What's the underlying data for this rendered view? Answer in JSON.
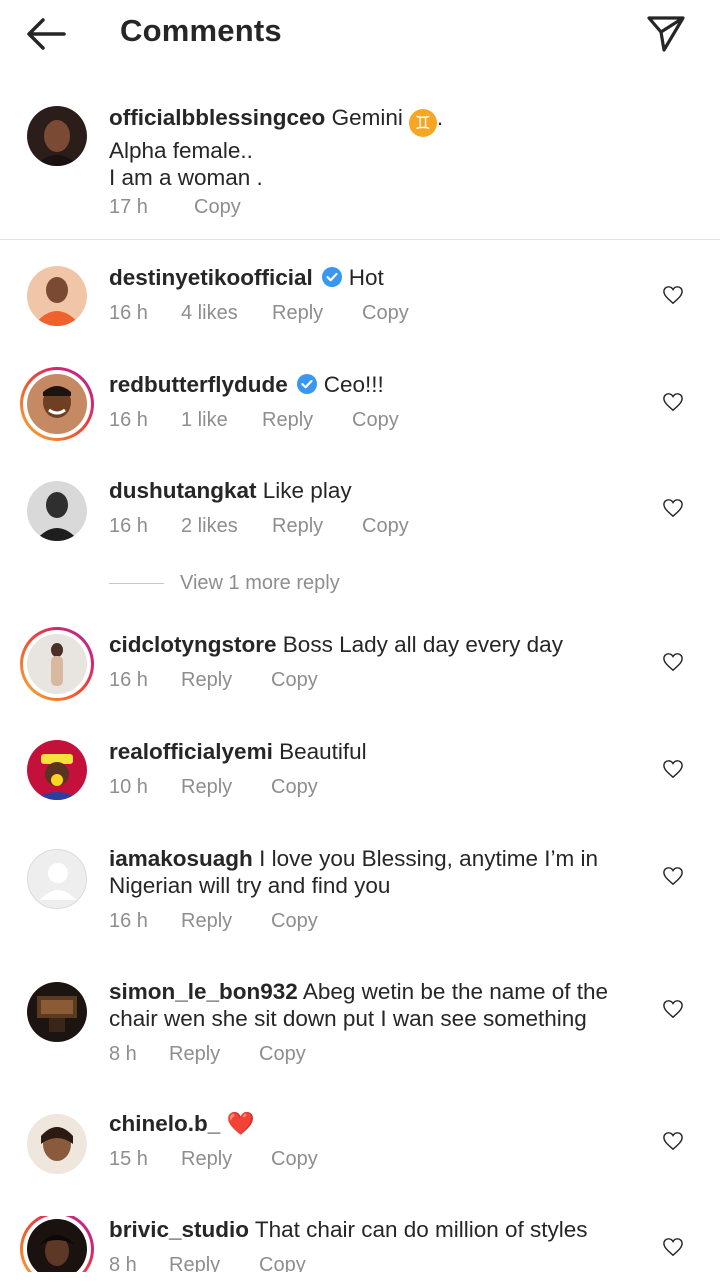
{
  "header": {
    "title": "Comments"
  },
  "caption": {
    "username": "officialbblessingceo",
    "text_line1": "Gemini",
    "zodiac_symbol": "♊",
    "text_after_symbol": ".",
    "text_line2": "Alpha female..",
    "text_line3": "I am a woman .",
    "time": "17 h",
    "copy": "Copy"
  },
  "comments": [
    {
      "username": "destinyetikoofficial",
      "verified": true,
      "text": "Hot",
      "time": "16 h",
      "likes": "4 likes",
      "reply": "Reply",
      "copy": "Copy"
    },
    {
      "username": "redbutterflydude",
      "verified": true,
      "text": "Ceo!!!",
      "time": "16 h",
      "likes": "1 like",
      "reply": "Reply",
      "copy": "Copy"
    },
    {
      "username": "dushutangkat",
      "verified": false,
      "text": "Like play",
      "time": "16 h",
      "likes": "2 likes",
      "reply": "Reply",
      "copy": "Copy"
    },
    {
      "username": "cidclotyngstore",
      "verified": false,
      "text": "Boss Lady all day every day",
      "time": "16 h",
      "reply": "Reply",
      "copy": "Copy"
    },
    {
      "username": "realofficialyemi",
      "verified": false,
      "text": "Beautiful",
      "time": "10 h",
      "reply": "Reply",
      "copy": "Copy"
    },
    {
      "username": "iamakosuagh",
      "verified": false,
      "text_line1": "I love you Blessing, anytime I’m in",
      "text_line2": "Nigerian will try and find you",
      "time": "16 h",
      "reply": "Reply",
      "copy": "Copy"
    },
    {
      "username": "simon_le_bon932",
      "verified": false,
      "text_line1": "Abeg wetin be the name of the",
      "text_line2": "chair wen she sit down put I wan see something",
      "time": "8 h",
      "reply": "Reply",
      "copy": "Copy"
    },
    {
      "username": "chinelo.b_",
      "verified": false,
      "text": "❤️",
      "time": "15 h",
      "reply": "Reply",
      "copy": "Copy"
    },
    {
      "username": "brivic_studio",
      "verified": false,
      "text": "That chair can do million of styles",
      "time": "8 h",
      "reply": "Reply",
      "copy": "Copy"
    }
  ],
  "view_more_replies": "View 1 more reply",
  "icons": {
    "back": "arrow-left-icon",
    "send": "paper-plane-icon",
    "like": "heart-outline-icon",
    "verified": "verified-badge-icon"
  },
  "colors": {
    "text": "#262626",
    "secondary": "#8e8e8e",
    "verified": "#3897f0",
    "heart": "#e02020"
  }
}
